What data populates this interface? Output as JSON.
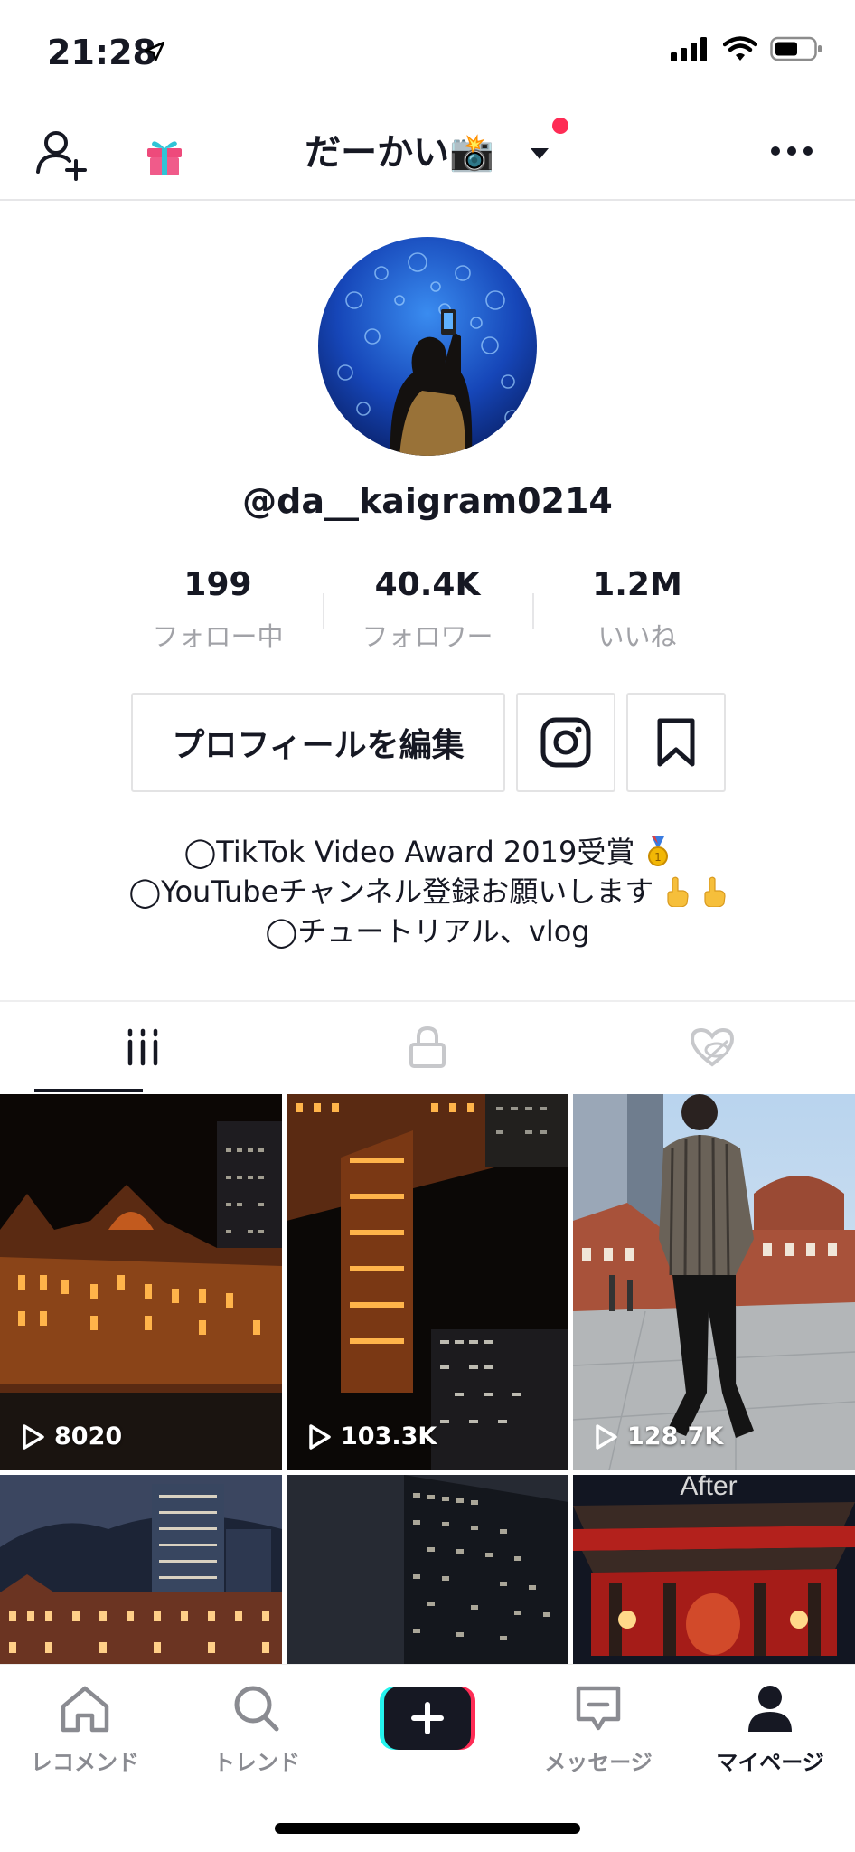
{
  "status_bar": {
    "time": "21:28"
  },
  "header": {
    "title": "だーかい📸"
  },
  "profile": {
    "handle": "@da__kaigram0214",
    "stats": [
      {
        "value": "199",
        "label": "フォロー中"
      },
      {
        "value": "40.4K",
        "label": "フォロワー"
      },
      {
        "value": "1.2M",
        "label": "いいね"
      }
    ],
    "edit_button": "プロフィールを編集",
    "bio": [
      "◯TikTok Video Award 2019受賞",
      "◯YouTubeチャンネル登録お願いします",
      "◯チュートリアル、vlog"
    ]
  },
  "tabs": [
    "videos-tab",
    "private-tab",
    "liked-tab"
  ],
  "videos": [
    {
      "views": "8020"
    },
    {
      "views": "103.3K"
    },
    {
      "views": "128.7K"
    },
    {
      "views": ""
    },
    {
      "views": ""
    },
    {
      "views": "",
      "overlay_text": "After"
    }
  ],
  "bottom_nav": [
    {
      "label": "レコメンド"
    },
    {
      "label": "トレンド"
    },
    {
      "label": ""
    },
    {
      "label": "メッセージ"
    },
    {
      "label": "マイページ"
    }
  ],
  "colors": {
    "accent": "#fe2c55",
    "cyan": "#25f4ee",
    "text": "#161823",
    "muted": "#a1a2a7"
  }
}
